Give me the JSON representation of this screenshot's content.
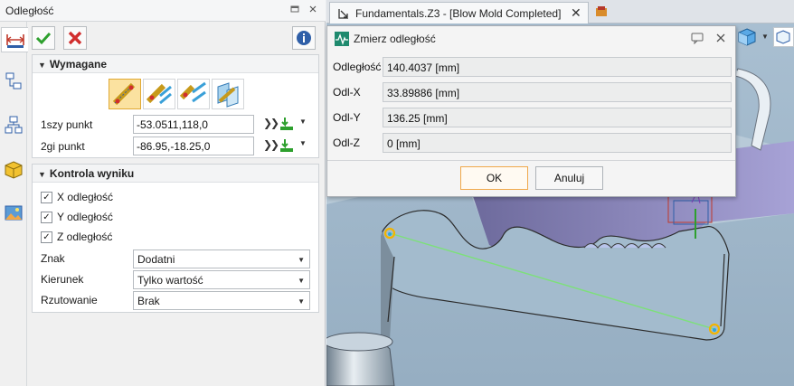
{
  "panel": {
    "title": "Odległość",
    "sections": {
      "required": {
        "title": "Wymagane",
        "point1": {
          "label": "1szy punkt",
          "value": "-53.0511,118,0"
        },
        "point2": {
          "label": "2gi punkt",
          "value": "-86.95,-18.25,0"
        }
      },
      "result": {
        "title": "Kontrola wyniku",
        "checks": [
          {
            "label": "X odległość",
            "checked": true
          },
          {
            "label": "Y odległość",
            "checked": true
          },
          {
            "label": "Z odległość",
            "checked": true
          }
        ],
        "sign": {
          "label": "Znak",
          "value": "Dodatni"
        },
        "direction": {
          "label": "Kierunek",
          "value": "Tylko wartość"
        },
        "projection": {
          "label": "Rzutowanie",
          "value": "Brak"
        }
      }
    },
    "check_mark": "✓"
  },
  "tab": {
    "title": "Fundamentals.Z3 - [Blow Mold Completed]"
  },
  "dialog": {
    "title": "Zmierz odległość",
    "rows": [
      {
        "label": "Odległość",
        "value": "140.4037  [mm]"
      },
      {
        "label": "Odl-X",
        "value": "33.89886  [mm]"
      },
      {
        "label": "Odl-Y",
        "value": "136.25  [mm]"
      },
      {
        "label": "Odl-Z",
        "value": "0  [mm]"
      }
    ],
    "ok_label": "OK",
    "cancel_label": "Anuluj"
  },
  "colors": {
    "viewport_bg": "#9fb6c8",
    "model_purple": "#8d86c4",
    "measure_line": "#7de07a",
    "marker": "#f2b400"
  }
}
